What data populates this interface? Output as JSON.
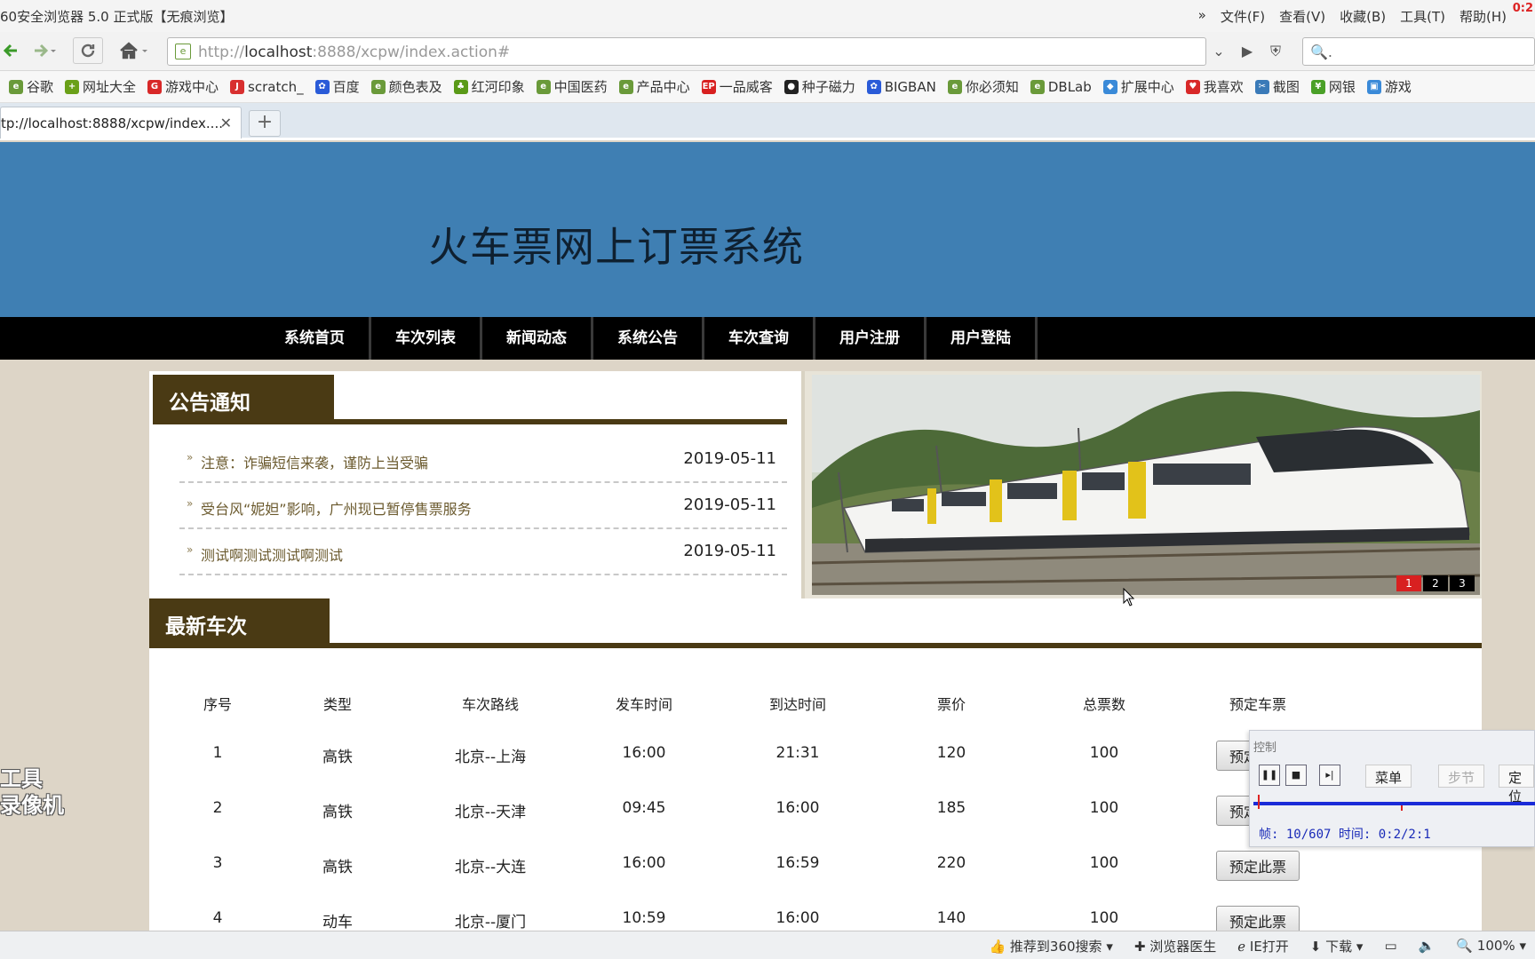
{
  "browser": {
    "window_title": "60安全浏览器 5.0 正式版【无痕浏览】",
    "menus": [
      "文件(F)",
      "查看(V)",
      "收藏(B)",
      "工具(T)",
      "帮助(H)"
    ],
    "menu_chevron": "»",
    "corner_text": "0:2",
    "url_prefix": "http://",
    "url_host": "localhost",
    "url_rest": ":8888/xcpw/index.action#",
    "search_placeholder": "🔍.",
    "bookmarks": [
      {
        "label": "谷歌",
        "icon": "e",
        "color": "#6a9a3a"
      },
      {
        "label": "网址大全",
        "icon": "+",
        "color": "#6aa018"
      },
      {
        "label": "游戏中心",
        "icon": "G",
        "color": "#d82828"
      },
      {
        "label": "scratch_",
        "icon": "J",
        "color": "#d83030"
      },
      {
        "label": "百度",
        "icon": "✿",
        "color": "#2a5bd8"
      },
      {
        "label": "颜色表及",
        "icon": "e",
        "color": "#6a9a3a"
      },
      {
        "label": "红河印象",
        "icon": "♣",
        "color": "#5a9a18"
      },
      {
        "label": "中国医药",
        "icon": "e",
        "color": "#6a9a3a"
      },
      {
        "label": "产品中心",
        "icon": "e",
        "color": "#6a9a3a"
      },
      {
        "label": "一品威客",
        "icon": "EP",
        "color": "#d82020"
      },
      {
        "label": "种子磁力",
        "icon": "●",
        "color": "#222"
      },
      {
        "label": "BIGBAN",
        "icon": "✿",
        "color": "#2a5bd8"
      },
      {
        "label": "你必须知",
        "icon": "e",
        "color": "#6a9a3a"
      },
      {
        "label": "DBLab",
        "icon": "e",
        "color": "#6a9a3a"
      },
      {
        "label": "扩展中心",
        "icon": "◆",
        "color": "#3a8ad8"
      },
      {
        "label": "我喜欢",
        "icon": "♥",
        "color": "#d82828"
      },
      {
        "label": "截图",
        "icon": "✂",
        "color": "#3a7ab8"
      },
      {
        "label": "网银",
        "icon": "¥",
        "color": "#4aa028"
      },
      {
        "label": "游戏",
        "icon": "▣",
        "color": "#3a8ad8"
      }
    ],
    "tab_title": "tp://localhost:8888/xcpw/index....",
    "tab_close": "✕",
    "new_tab": "+"
  },
  "site": {
    "title": "火车票网上订票系统",
    "nav": [
      "系统首页",
      "车次列表",
      "新闻动态",
      "系统公告",
      "车次查询",
      "用户注册",
      "用户登陆"
    ]
  },
  "notices": {
    "heading": "公告通知",
    "bullet": "»",
    "items": [
      {
        "title": "注意：诈骗短信来袭，谨防上当受骗",
        "date": "2019-05-11"
      },
      {
        "title": "受台风“妮妲”影响，广州现已暂停售票服务",
        "date": "2019-05-11"
      },
      {
        "title": "测试啊测试测试啊测试",
        "date": "2019-05-11"
      }
    ]
  },
  "banner": {
    "pages": [
      "1",
      "2",
      "3"
    ],
    "active_page": 1
  },
  "trains": {
    "heading": "最新车次",
    "columns": [
      "序号",
      "类型",
      "车次路线",
      "发车时间",
      "到达时间",
      "票价",
      "总票数",
      "预定车票"
    ],
    "rows": [
      {
        "no": "1",
        "type": "高铁",
        "route": "北京--上海",
        "depart": "16:00",
        "arrive": "21:31",
        "price": "120",
        "total": "100",
        "action": "预定此票"
      },
      {
        "no": "2",
        "type": "高铁",
        "route": "北京--天津",
        "depart": "09:45",
        "arrive": "16:00",
        "price": "185",
        "total": "100",
        "action": "预定此票"
      },
      {
        "no": "3",
        "type": "高铁",
        "route": "北京--大连",
        "depart": "16:00",
        "arrive": "16:59",
        "price": "220",
        "total": "100",
        "action": "预定此票"
      },
      {
        "no": "4",
        "type": "动车",
        "route": "北京--厦门",
        "depart": "10:59",
        "arrive": "16:00",
        "price": "140",
        "total": "100",
        "action": "预定此票"
      }
    ]
  },
  "recorder": {
    "title": "控制",
    "menu_label": "菜单",
    "step_label": "步节",
    "locate_label": "定位",
    "info": "帧: 10/607 时间: 0:2/2:1",
    "progress": 0.016,
    "watermark": [
      "工具",
      "录像机"
    ]
  },
  "statusbar": {
    "items": [
      "推荐到360搜索",
      "浏览器医生",
      "IE打开",
      "下载",
      "100%"
    ]
  }
}
